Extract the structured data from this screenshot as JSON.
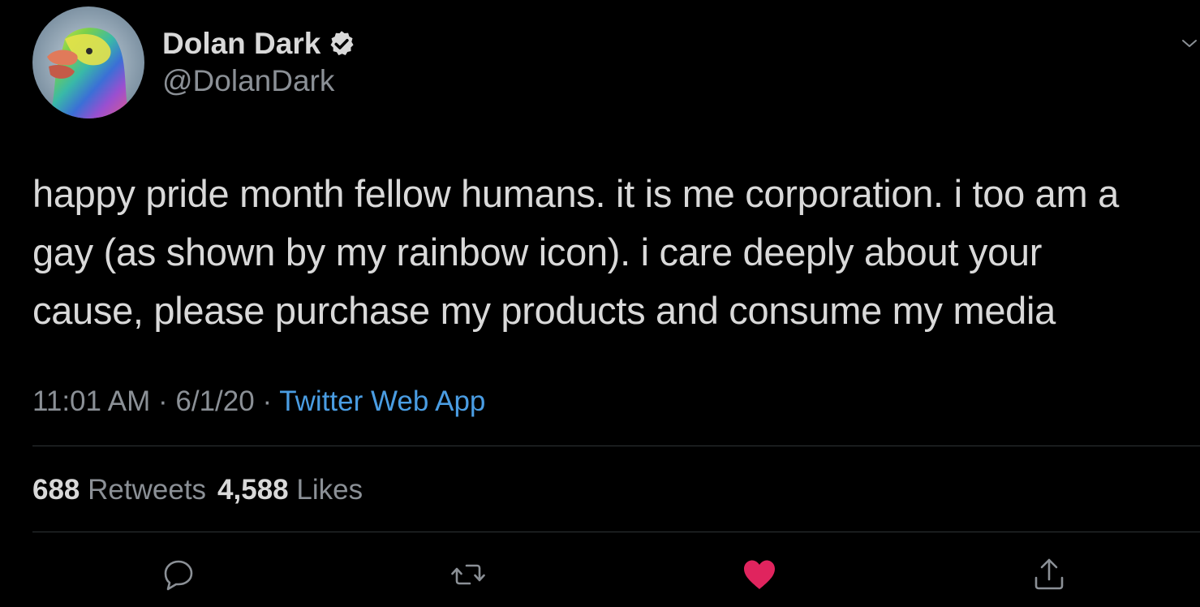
{
  "tweet": {
    "author": {
      "display_name": "Dolan Dark",
      "handle": "@DolanDark",
      "verified": true,
      "avatar_icon": "rainbow-duck-avatar"
    },
    "text": "happy pride month fellow humans. it is me corporation. i too am a\ngay (as shown by my rainbow icon). i care deeply about your\ncause, please purchase my products and consume my media",
    "time": "11:01 AM",
    "separator": "·",
    "date": "6/1/20",
    "source": "Twitter Web App",
    "stats": {
      "retweets_count": "688",
      "retweets_label": "Retweets",
      "likes_count": "4,588",
      "likes_label": "Likes"
    },
    "actions": {
      "reply_icon": "reply-icon",
      "retweet_icon": "retweet-icon",
      "like_icon": "heart-icon",
      "share_icon": "share-icon",
      "liked": true
    }
  },
  "colors": {
    "background": "#000000",
    "primary_text": "#d9d9d9",
    "secondary_text": "#8b9096",
    "link": "#4a9de3",
    "like": "#e0245e",
    "divider": "#2f3336"
  }
}
